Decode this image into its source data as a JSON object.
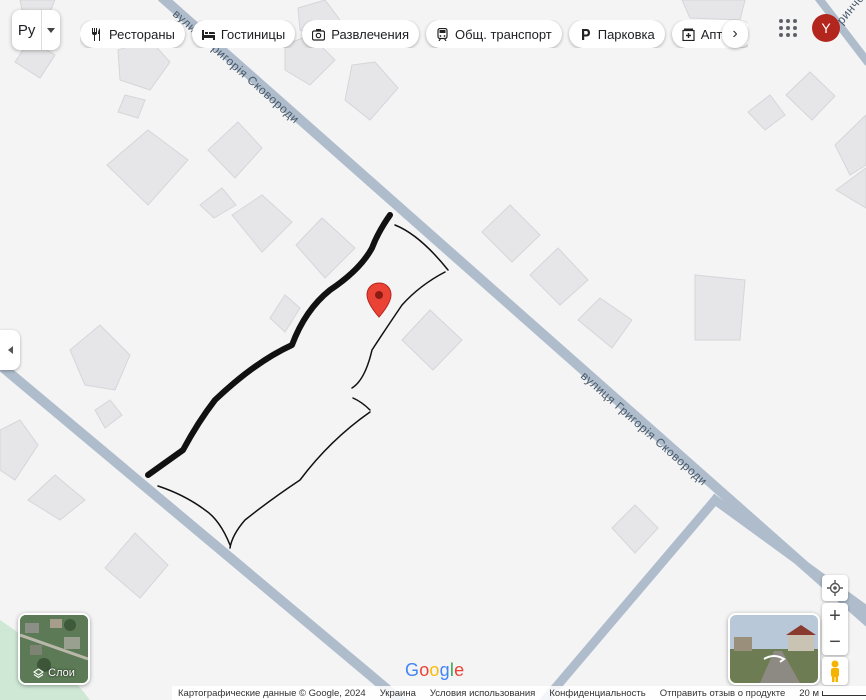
{
  "search": {
    "value": "Ру"
  },
  "chips": [
    {
      "label": "Рестораны",
      "icon": "fork-knife-icon"
    },
    {
      "label": "Гостиницы",
      "icon": "bed-icon"
    },
    {
      "label": "Развлечения",
      "icon": "camera-icon"
    },
    {
      "label": "Общ. транспорт",
      "icon": "train-icon"
    },
    {
      "label": "Парковка",
      "icon": "parking-icon"
    },
    {
      "label": "Аптеки",
      "icon": "pharmacy-icon"
    }
  ],
  "account": {
    "initial": "Y",
    "color": "#b3261e"
  },
  "map": {
    "street_main": "вулиця Григорія Сковороди",
    "street_top": "вулиця Григорія Сковороди",
    "street_corner": "Гринчева"
  },
  "layers": {
    "label": "Слои"
  },
  "logo": {
    "text": "Google"
  },
  "footer": {
    "map_data": "Картографические данные © Google, 2024",
    "country": "Украина",
    "terms": "Условия использования",
    "privacy": "Конфиденциальность",
    "feedback": "Отправить отзыв о продукте",
    "scale": "20 м"
  },
  "colors": {
    "road": "#aebccc",
    "building": "#e7e7ea",
    "pin": "#ea4335"
  }
}
